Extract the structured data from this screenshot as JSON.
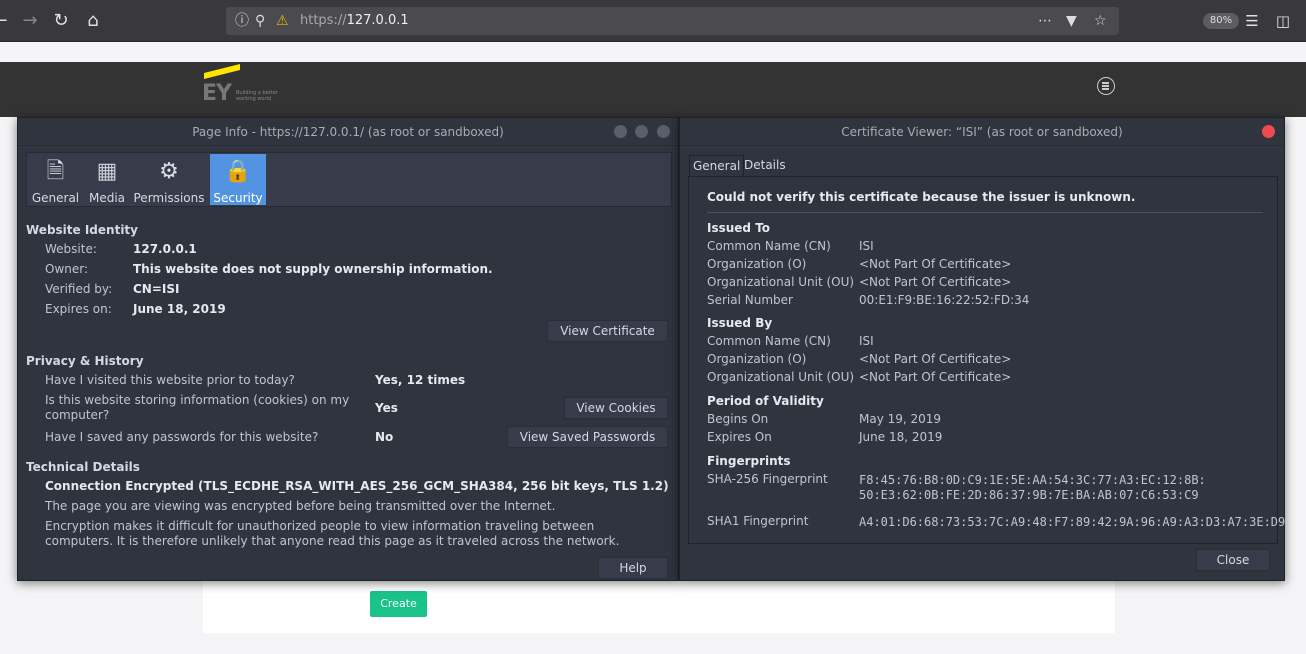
{
  "browser": {
    "url_scheme": "https://",
    "url_host": "127.0.0.1",
    "zoom": "80%"
  },
  "page": {
    "logo_text": "EY",
    "logo_tagline": "Building a better working world",
    "create_button": "Create"
  },
  "page_info": {
    "title": "Page Info - https://127.0.0.1/ (as root or sandboxed)",
    "tabs": [
      {
        "label": "General",
        "icon": "general-icon"
      },
      {
        "label": "Media",
        "icon": "media-icon"
      },
      {
        "label": "Permissions",
        "icon": "permissions-icon"
      },
      {
        "label": "Security",
        "icon": "lock-icon"
      }
    ],
    "identity": {
      "heading": "Website Identity",
      "website_label": "Website:",
      "website_value": "127.0.0.1",
      "owner_label": "Owner:",
      "owner_value": "This website does not supply ownership information.",
      "verified_label": "Verified by:",
      "verified_value": "CN=ISI",
      "expires_label": "Expires on:",
      "expires_value": "June 18, 2019",
      "view_cert_button": "View Certificate"
    },
    "privacy": {
      "heading": "Privacy & History",
      "q1": "Have I visited this website prior to today?",
      "a1": "Yes, 12 times",
      "q2": "Is this website storing information (cookies) on my computer?",
      "a2": "Yes",
      "view_cookies_button": "View Cookies",
      "q3": "Have I saved any passwords for this website?",
      "a3": "No",
      "view_passwords_button": "View Saved Passwords"
    },
    "technical": {
      "heading": "Technical Details",
      "connection": "Connection Encrypted (TLS_ECDHE_RSA_WITH_AES_256_GCM_SHA384, 256 bit keys, TLS 1.2)",
      "line1": "The page you are viewing was encrypted before being transmitted over the Internet.",
      "line2": "Encryption makes it difficult for unauthorized people to view information traveling between computers. It is therefore unlikely that anyone read this page as it traveled across the network."
    },
    "help_button": "Help"
  },
  "cert_viewer": {
    "title": "Certificate Viewer: “ISI” (as root or sandboxed)",
    "tabs": [
      "General",
      "Details"
    ],
    "warning": "Could not verify this certificate because the issuer is unknown.",
    "issued_to": {
      "heading": "Issued To",
      "cn_label": "Common Name (CN)",
      "cn_value": "ISI",
      "o_label": "Organization (O)",
      "o_value": "<Not Part Of Certificate>",
      "ou_label": "Organizational Unit (OU)",
      "ou_value": "<Not Part Of Certificate>",
      "serial_label": "Serial Number",
      "serial_value": "00:E1:F9:BE:16:22:52:FD:34"
    },
    "issued_by": {
      "heading": "Issued By",
      "cn_label": "Common Name (CN)",
      "cn_value": "ISI",
      "o_label": "Organization (O)",
      "o_value": "<Not Part Of Certificate>",
      "ou_label": "Organizational Unit (OU)",
      "ou_value": "<Not Part Of Certificate>"
    },
    "validity": {
      "heading": "Period of Validity",
      "begins_label": "Begins On",
      "begins_value": "May 19, 2019",
      "expires_label": "Expires On",
      "expires_value": "June 18, 2019"
    },
    "fingerprints": {
      "heading": "Fingerprints",
      "sha256_label": "SHA-256 Fingerprint",
      "sha256_line1": "F8:45:76:B8:0D:C9:1E:5E:AA:54:3C:77:A3:EC:12:8B:",
      "sha256_line2": "50:E3:62:0B:FE:2D:86:37:9B:7E:BA:AB:07:C6:53:C9",
      "sha1_label": "SHA1 Fingerprint",
      "sha1_value": "A4:01:D6:68:73:53:7C:A9:48:F7:89:42:9A:96:A9:A3:D3:A7:3E:D9"
    },
    "close_button": "Close"
  }
}
